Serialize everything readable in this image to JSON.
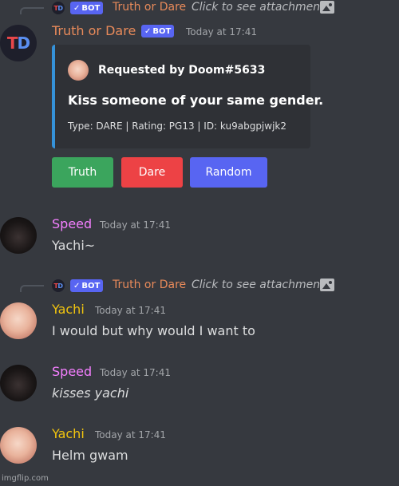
{
  "bot_tag": {
    "check": "✓",
    "label": "BOT"
  },
  "colors": {
    "speed": "#f47fff",
    "yachi": "#f1c40f",
    "bot_name": "#e88a5a",
    "embed_border": "#3592d9"
  },
  "reply1": {
    "avatar_letters": [
      "T",
      "D"
    ],
    "name": "Truth or Dare",
    "text": "Click to see attachment",
    "icon": "image-icon"
  },
  "message1": {
    "avatar_letters": [
      "T",
      "D"
    ],
    "author": "Truth or Dare",
    "timestamp": "Today at 17:41",
    "embed": {
      "author": "Requested by Doom#5633",
      "title": "Kiss someone of your same gender.",
      "footer": "Type: DARE | Rating: PG13 | ID: ku9abgpjwjk2"
    },
    "buttons": [
      {
        "label": "Truth",
        "color": "#3ba55d"
      },
      {
        "label": "Dare",
        "color": "#ed4245"
      },
      {
        "label": "Random",
        "color": "#5865f2"
      }
    ]
  },
  "message2": {
    "author": "Speed",
    "timestamp": "Today at 17:41",
    "text": "Yachi~"
  },
  "reply2": {
    "avatar_letters": [
      "T",
      "D"
    ],
    "name": "Truth or Dare",
    "text": "Click to see attachment",
    "icon": "image-icon"
  },
  "message3": {
    "author": "Yachi",
    "timestamp": "Today at 17:41",
    "text": "I would but why would I want to"
  },
  "message4": {
    "author": "Speed",
    "timestamp": "Today at 17:41",
    "text": "kisses yachi"
  },
  "message5": {
    "author": "Yachi",
    "timestamp": "Today at 17:41",
    "text": "Helm gwam"
  },
  "watermark": "imgflip.com"
}
